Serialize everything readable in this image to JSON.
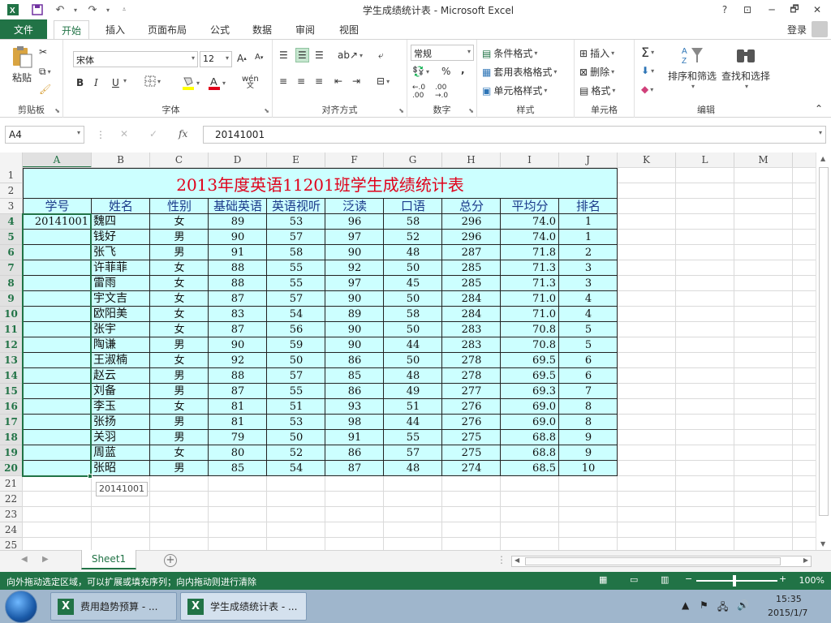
{
  "window": {
    "title": "学生成绩统计表 - Microsoft Excel",
    "help": "?",
    "minimize": "─",
    "maximize": "🗗",
    "close": "✕"
  },
  "tabs": {
    "file": "文件",
    "items": [
      "开始",
      "插入",
      "页面布局",
      "公式",
      "数据",
      "审阅",
      "视图"
    ],
    "active": "开始",
    "login": "登录"
  },
  "ribbon": {
    "clipboard": {
      "label": "剪贴板",
      "paste": "粘贴"
    },
    "font": {
      "label": "字体",
      "name": "宋体",
      "size": "12",
      "bold": "B",
      "italic": "I",
      "underline": "U",
      "wen": "wén"
    },
    "align": {
      "label": "对齐方式"
    },
    "number": {
      "label": "数字",
      "format": "常规",
      "percent": "%",
      "comma": ","
    },
    "styles": {
      "label": "样式",
      "cond": "条件格式",
      "table": "套用表格格式",
      "cell": "单元格样式"
    },
    "cells": {
      "label": "单元格",
      "insert": "插入",
      "delete": "删除",
      "format": "格式"
    },
    "editing": {
      "label": "编辑",
      "sort": "排序和筛选",
      "find": "查找和选择"
    }
  },
  "formula_bar": {
    "name_box": "A4",
    "formula": "20141001",
    "fx": "fx"
  },
  "columns": [
    "A",
    "B",
    "C",
    "D",
    "E",
    "F",
    "G",
    "H",
    "I",
    "J",
    "K",
    "L",
    "M"
  ],
  "rows": [
    "1",
    "2",
    "3",
    "4",
    "5",
    "6",
    "7",
    "8",
    "9",
    "10",
    "11",
    "12",
    "13",
    "14",
    "15",
    "16",
    "17",
    "18",
    "19",
    "20",
    "21",
    "22",
    "23",
    "24",
    "25"
  ],
  "sheet_title": "2013年度英语11201班学生成绩统计表",
  "headers": [
    "学号",
    "姓名",
    "性别",
    "基础英语",
    "英语视听",
    "泛读",
    "口语",
    "总分",
    "平均分",
    "排名"
  ],
  "data_rows": [
    [
      "20141001",
      "魏四",
      "女",
      "89",
      "53",
      "96",
      "58",
      "296",
      "74.0",
      "1"
    ],
    [
      "",
      "钱好",
      "男",
      "90",
      "57",
      "97",
      "52",
      "296",
      "74.0",
      "1"
    ],
    [
      "",
      "张飞",
      "男",
      "91",
      "58",
      "90",
      "48",
      "287",
      "71.8",
      "2"
    ],
    [
      "",
      "许菲菲",
      "女",
      "88",
      "55",
      "92",
      "50",
      "285",
      "71.3",
      "3"
    ],
    [
      "",
      "雷雨",
      "女",
      "88",
      "55",
      "97",
      "45",
      "285",
      "71.3",
      "3"
    ],
    [
      "",
      "宇文吉",
      "女",
      "87",
      "57",
      "90",
      "50",
      "284",
      "71.0",
      "4"
    ],
    [
      "",
      "欧阳美",
      "女",
      "83",
      "54",
      "89",
      "58",
      "284",
      "71.0",
      "4"
    ],
    [
      "",
      "张宇",
      "女",
      "87",
      "56",
      "90",
      "50",
      "283",
      "70.8",
      "5"
    ],
    [
      "",
      "陶谦",
      "男",
      "90",
      "59",
      "90",
      "44",
      "283",
      "70.8",
      "5"
    ],
    [
      "",
      "王淑楠",
      "女",
      "92",
      "50",
      "86",
      "50",
      "278",
      "69.5",
      "6"
    ],
    [
      "",
      "赵云",
      "男",
      "88",
      "57",
      "85",
      "48",
      "278",
      "69.5",
      "6"
    ],
    [
      "",
      "刘备",
      "男",
      "87",
      "55",
      "86",
      "49",
      "277",
      "69.3",
      "7"
    ],
    [
      "",
      "李玉",
      "女",
      "81",
      "51",
      "93",
      "51",
      "276",
      "69.0",
      "8"
    ],
    [
      "",
      "张扬",
      "男",
      "81",
      "53",
      "98",
      "44",
      "276",
      "69.0",
      "8"
    ],
    [
      "",
      "关羽",
      "男",
      "79",
      "50",
      "91",
      "55",
      "275",
      "68.8",
      "9"
    ],
    [
      "",
      "周蓝",
      "女",
      "80",
      "52",
      "86",
      "57",
      "275",
      "68.8",
      "9"
    ],
    [
      "",
      "张昭",
      "男",
      "85",
      "54",
      "87",
      "48",
      "274",
      "68.5",
      "10"
    ]
  ],
  "fill_tooltip": "20141001",
  "sheet_tab": "Sheet1",
  "status": {
    "message": "向外拖动选定区域，可以扩展或填充序列；向内拖动则进行清除",
    "zoom": "100%"
  },
  "taskbar": {
    "items": [
      "费用趋势预算 - ...",
      "学生成绩统计表 - ..."
    ],
    "time": "15:35",
    "date": "2015/1/7"
  },
  "colors": {
    "accent": "#217346",
    "table_fill": "#ccffff",
    "title_red": "#e0001a",
    "header_blue": "#1a3a8a"
  }
}
